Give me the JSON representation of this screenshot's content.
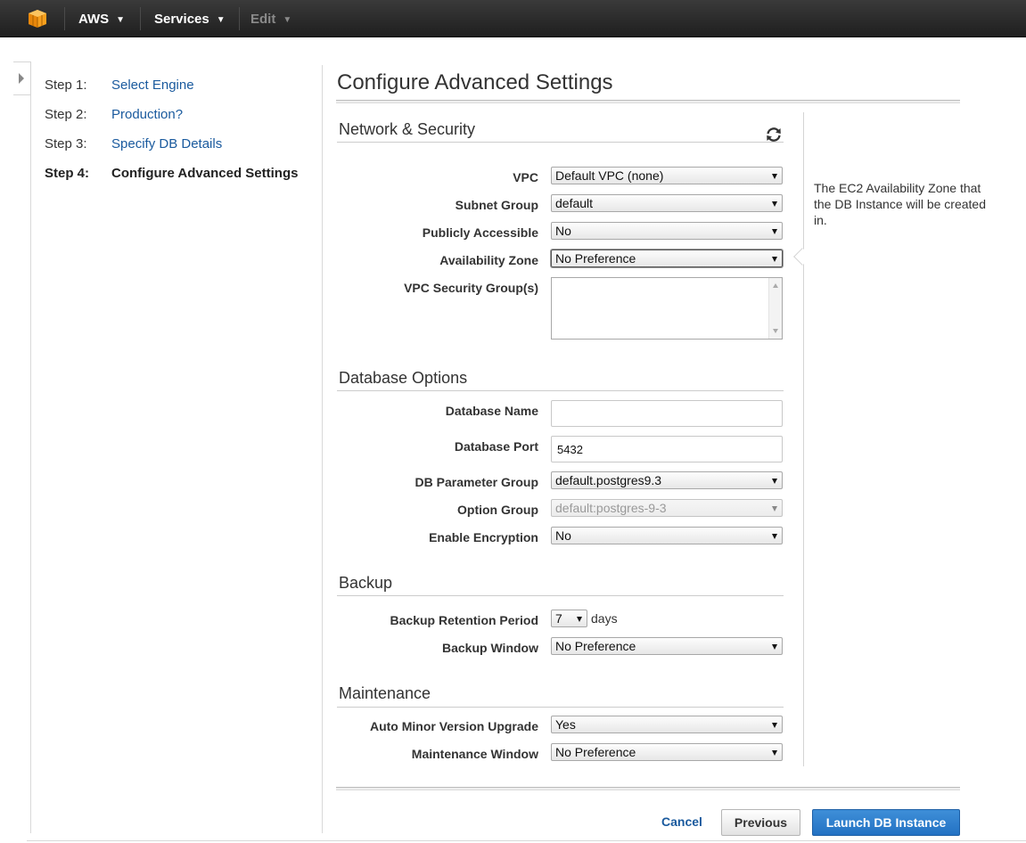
{
  "topbar": {
    "brand": "AWS",
    "services": "Services",
    "edit": "Edit"
  },
  "steps": [
    {
      "num": "Step 1:",
      "label": "Select Engine"
    },
    {
      "num": "Step 2:",
      "label": "Production?"
    },
    {
      "num": "Step 3:",
      "label": "Specify DB Details"
    },
    {
      "num": "Step 4:",
      "label": "Configure Advanced Settings"
    }
  ],
  "page_title": "Configure Advanced Settings",
  "network": {
    "title": "Network & Security",
    "vpc": {
      "label": "VPC",
      "value": "Default VPC (none)"
    },
    "subnet_group": {
      "label": "Subnet Group",
      "value": "default"
    },
    "publicly_accessible": {
      "label": "Publicly Accessible",
      "value": "No"
    },
    "availability_zone": {
      "label": "Availability Zone",
      "value": "No Preference"
    },
    "security_groups": {
      "label": "VPC Security Group(s)"
    }
  },
  "help_text": "The EC2 Availability Zone that the DB Instance will be created in.",
  "database": {
    "title": "Database Options",
    "name": {
      "label": "Database Name",
      "value": ""
    },
    "port": {
      "label": "Database Port",
      "value": "5432"
    },
    "param_group": {
      "label": "DB Parameter Group",
      "value": "default.postgres9.3"
    },
    "option_group": {
      "label": "Option Group",
      "value": "default:postgres-9-3"
    },
    "encryption": {
      "label": "Enable Encryption",
      "value": "No"
    }
  },
  "backup": {
    "title": "Backup",
    "retention": {
      "label": "Backup Retention Period",
      "value": "7",
      "unit": "days"
    },
    "window": {
      "label": "Backup Window",
      "value": "No Preference"
    }
  },
  "maintenance": {
    "title": "Maintenance",
    "auto_minor": {
      "label": "Auto Minor Version Upgrade",
      "value": "Yes"
    },
    "window": {
      "label": "Maintenance Window",
      "value": "No Preference"
    }
  },
  "footer": {
    "cancel": "Cancel",
    "previous": "Previous",
    "launch": "Launch DB Instance"
  }
}
